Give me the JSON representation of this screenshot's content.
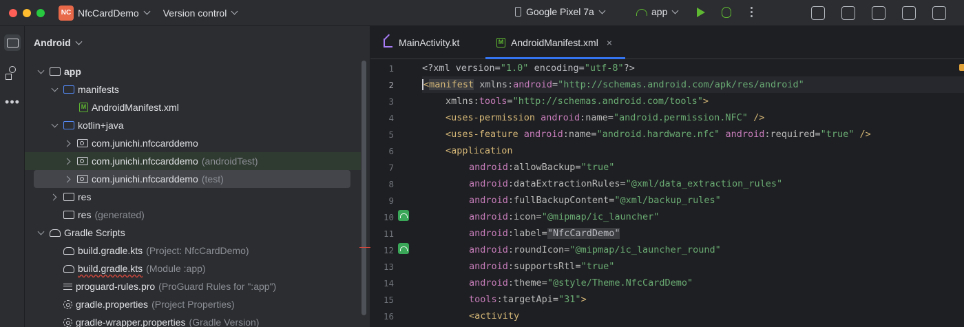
{
  "titlebar": {
    "project_initials": "NC",
    "project_name": "NfcCardDemo",
    "vcs_label": "Version control",
    "device": "Google Pixel 7a",
    "run_config": "app"
  },
  "sidebar": {
    "view_mode": "Android"
  },
  "tree": [
    {
      "label": "app",
      "hint": "",
      "bold": true
    },
    {
      "label": "manifests",
      "hint": ""
    },
    {
      "label": "AndroidManifest.xml",
      "hint": ""
    },
    {
      "label": "kotlin+java",
      "hint": ""
    },
    {
      "label": "com.junichi.nfccarddemo",
      "hint": ""
    },
    {
      "label": "com.junichi.nfccarddemo",
      "hint": "(androidTest)"
    },
    {
      "label": "com.junichi.nfccarddemo",
      "hint": "(test)"
    },
    {
      "label": "res",
      "hint": ""
    },
    {
      "label": "res",
      "hint": "(generated)"
    },
    {
      "label": "Gradle Scripts",
      "hint": ""
    },
    {
      "label": "build.gradle.kts",
      "hint": "(Project: NfcCardDemo)"
    },
    {
      "label": "build.gradle.kts",
      "hint": "(Module :app)"
    },
    {
      "label": "proguard-rules.pro",
      "hint": "(ProGuard Rules for \":app\")"
    },
    {
      "label": "gradle.properties",
      "hint": "(Project Properties)"
    },
    {
      "label": "gradle-wrapper.properties",
      "hint": "(Gradle Version)"
    }
  ],
  "tabs": [
    {
      "label": "MainActivity.kt"
    },
    {
      "label": "AndroidManifest.xml",
      "close": "×"
    }
  ],
  "lines": [
    "1",
    "2",
    "3",
    "4",
    "5",
    "6",
    "7",
    "8",
    "9",
    "10",
    "11",
    "12",
    "13",
    "14",
    "15",
    "16"
  ],
  "code": {
    "l1": {
      "a": "<?xml version=",
      "b": "\"1.0\"",
      "c": " encoding=",
      "d": "\"utf-8\"",
      "e": "?>"
    },
    "l2": {
      "a": "<",
      "b": "manifest",
      "c": " xmlns:",
      "d": "android",
      "e": "=",
      "f": "\"http://schemas.android.com/apk/res/android\""
    },
    "l3": {
      "a": "xmlns:",
      "b": "tools",
      "c": "=",
      "d": "\"http://schemas.android.com/tools\"",
      "e": ">"
    },
    "l4": {
      "a": "<uses-permission ",
      "b": "android",
      "c": ":name=",
      "d": "\"android.permission.NFC\"",
      "e": " />"
    },
    "l5": {
      "a": "<uses-feature ",
      "b": "android",
      "c": ":name=",
      "d": "\"android.hardware.nfc\"",
      "e": " ",
      "f": "android",
      "g": ":required=",
      "h": "\"true\"",
      "i": " />"
    },
    "l6": {
      "a": "<application"
    },
    "l7": {
      "a": "android",
      "b": ":allowBackup=",
      "c": "\"true\""
    },
    "l8": {
      "a": "android",
      "b": ":dataExtractionRules=",
      "c": "\"@xml/data_extraction_rules\""
    },
    "l9": {
      "a": "android",
      "b": ":fullBackupContent=",
      "c": "\"@xml/backup_rules\""
    },
    "l10": {
      "a": "android",
      "b": ":icon=",
      "c": "\"@mipmap/ic_launcher\""
    },
    "l11": {
      "a": "android",
      "b": ":label=",
      "c": "\"NfcCardDemo\""
    },
    "l12": {
      "a": "android",
      "b": ":roundIcon=",
      "c": "\"@mipmap/ic_launcher_round\""
    },
    "l13": {
      "a": "android",
      "b": ":supportsRtl=",
      "c": "\"true\""
    },
    "l14": {
      "a": "android",
      "b": ":theme=",
      "c": "\"@style/Theme.NfcCardDemo\""
    },
    "l15": {
      "a": "tools",
      "b": ":targetApi=",
      "c": "\"31\"",
      "d": ">"
    },
    "l16": {
      "a": "<activity"
    }
  },
  "colors": {
    "accent": "#3574f0",
    "run_green": "#5fb832",
    "badge": "#e8684a"
  }
}
